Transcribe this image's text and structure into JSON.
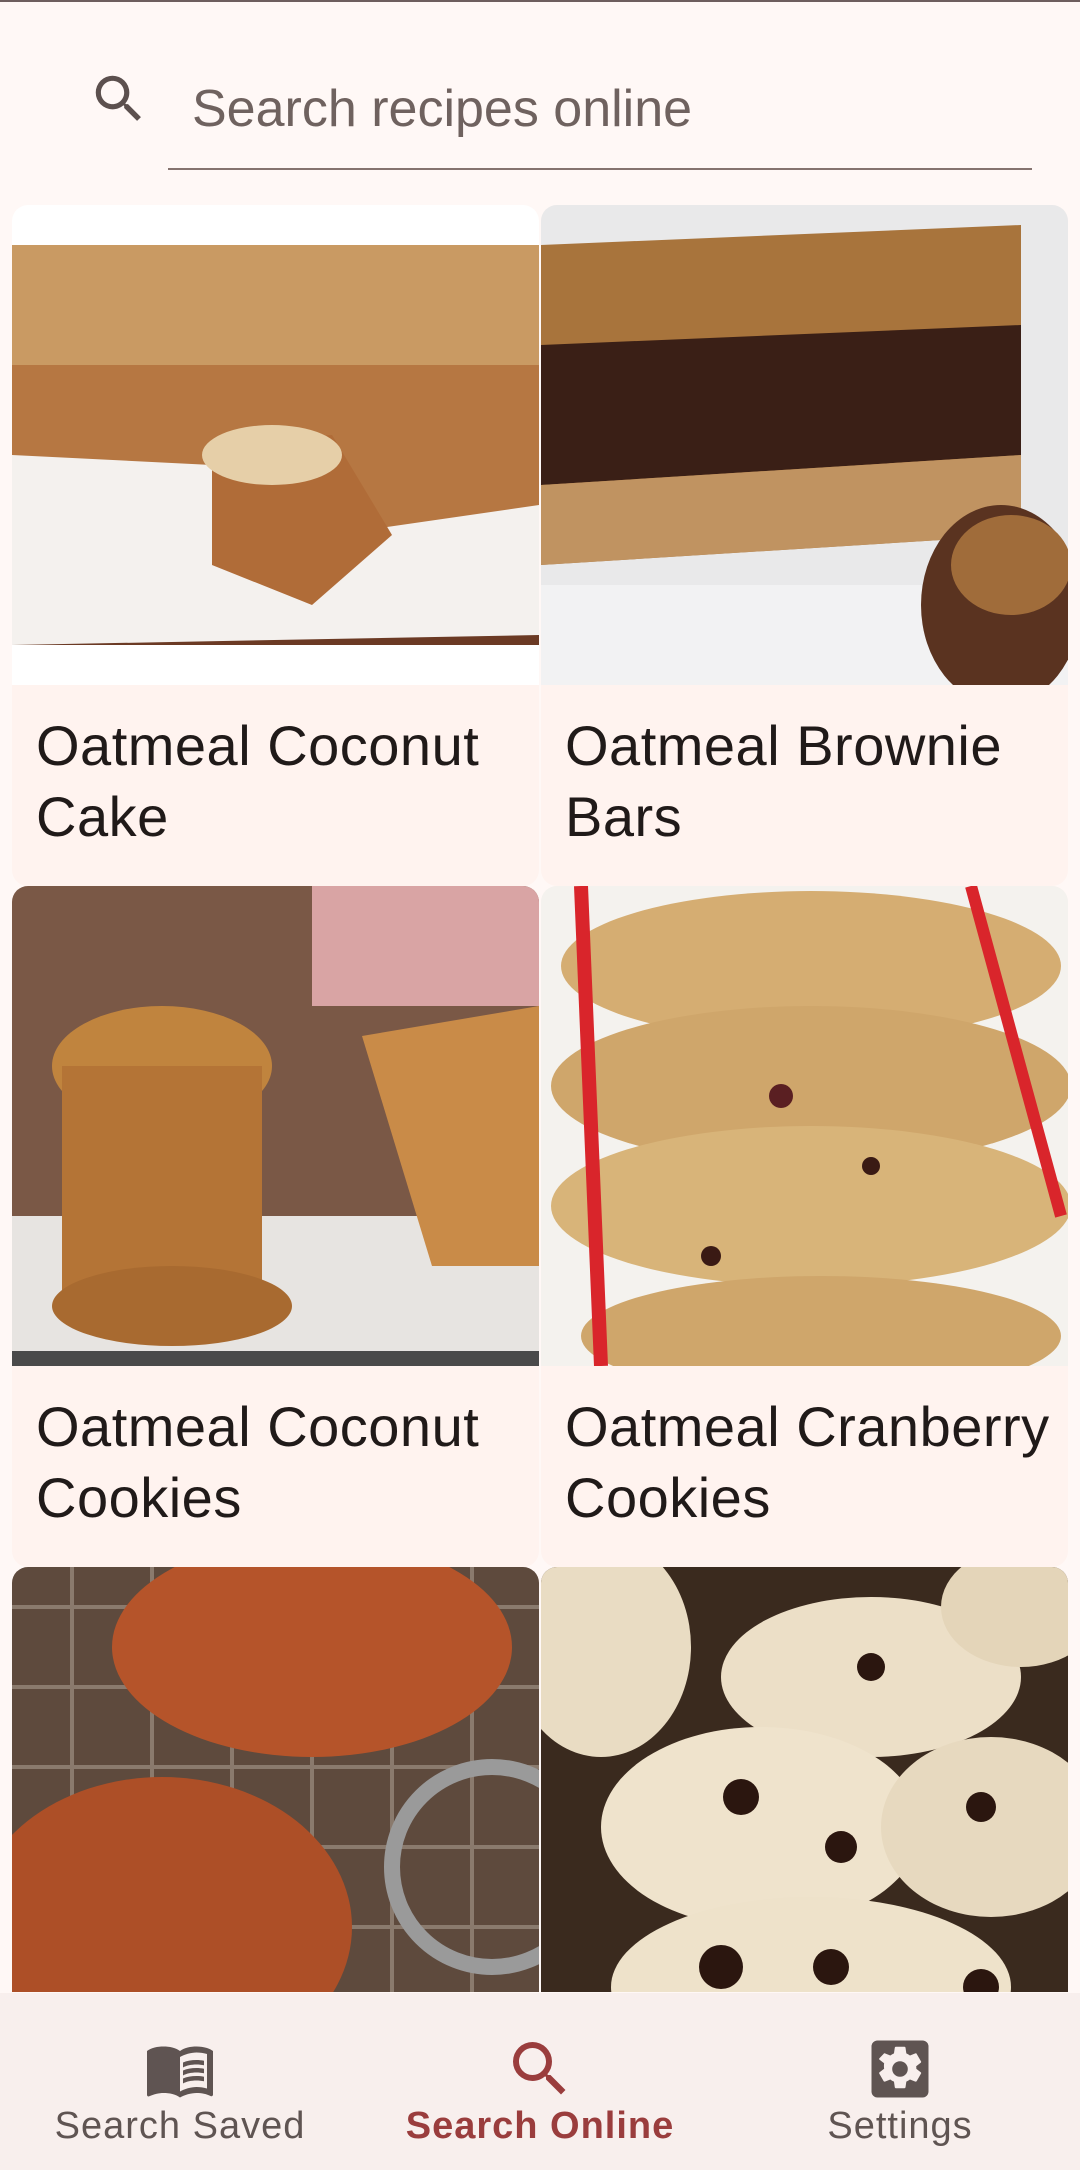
{
  "search": {
    "placeholder": "Search recipes online",
    "value": ""
  },
  "recipes": [
    {
      "title": "Oatmeal Coconut\nCake"
    },
    {
      "title": "Oatmeal Brownie\nBars"
    },
    {
      "title": "Oatmeal Coconut\nCookies"
    },
    {
      "title": "Oatmeal Cranberry\nCookies"
    },
    {
      "title": ""
    },
    {
      "title": ""
    }
  ],
  "nav": {
    "items": [
      {
        "label": "Search Saved",
        "icon": "book-icon",
        "active": false
      },
      {
        "label": "Search Online",
        "icon": "search-icon",
        "active": true
      },
      {
        "label": "Settings",
        "icon": "gear-icon",
        "active": false
      }
    ]
  },
  "colors": {
    "accent": "#9a3d3d",
    "background": "#fff8f6",
    "card": "#fff3ef",
    "nav_background": "#f8efed"
  }
}
